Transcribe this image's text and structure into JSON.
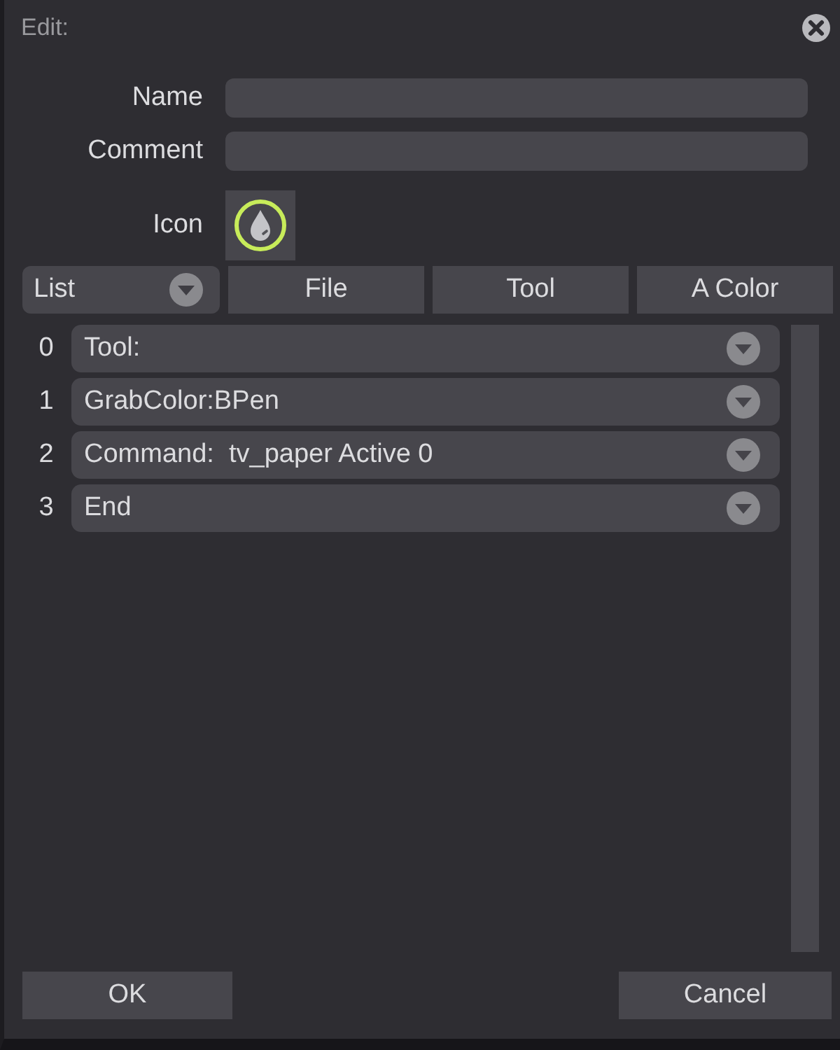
{
  "window": {
    "title": "Edit:"
  },
  "fields": [
    {
      "label": "Name"
    },
    {
      "label": "Comment"
    }
  ],
  "icon": {
    "label": "Icon"
  },
  "toolbar": {
    "dropdown": "List",
    "buttons": [
      "File",
      "Tool",
      "A Color"
    ]
  },
  "rows": [
    {
      "index": "0",
      "text": "Tool:"
    },
    {
      "index": "1",
      "text": "GrabColor:BPen"
    },
    {
      "index": "2",
      "text": "Command:  tv_paper Active 0"
    },
    {
      "index": "3",
      "text": "End"
    }
  ],
  "buttons": {
    "ok": "OK",
    "cancel": "Cancel"
  }
}
